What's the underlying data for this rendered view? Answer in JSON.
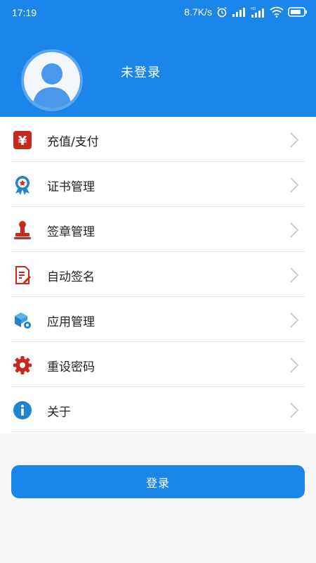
{
  "status_bar": {
    "time": "17:19",
    "network_speed": "8.7K/s",
    "icons": [
      "alarm-icon",
      "signal-icon",
      "signal-hd-icon",
      "wifi-icon",
      "battery-icon"
    ]
  },
  "profile": {
    "avatar_icon": "user-avatar-icon",
    "login_status": "未登录"
  },
  "menu": {
    "items": [
      {
        "label": "充值/支付",
        "icon": "yuan-icon"
      },
      {
        "label": "证书管理",
        "icon": "certificate-badge-icon"
      },
      {
        "label": "签章管理",
        "icon": "stamp-icon"
      },
      {
        "label": "自动签名",
        "icon": "document-sign-icon"
      },
      {
        "label": "应用管理",
        "icon": "app-box-gear-icon"
      },
      {
        "label": "重设密码",
        "icon": "gear-icon"
      },
      {
        "label": "关于",
        "icon": "info-icon"
      }
    ]
  },
  "login_button": {
    "label": "登录"
  },
  "colors": {
    "primary": "#1a86ea",
    "red_icon": "#c9281d",
    "blue_icon": "#1f84d0"
  }
}
